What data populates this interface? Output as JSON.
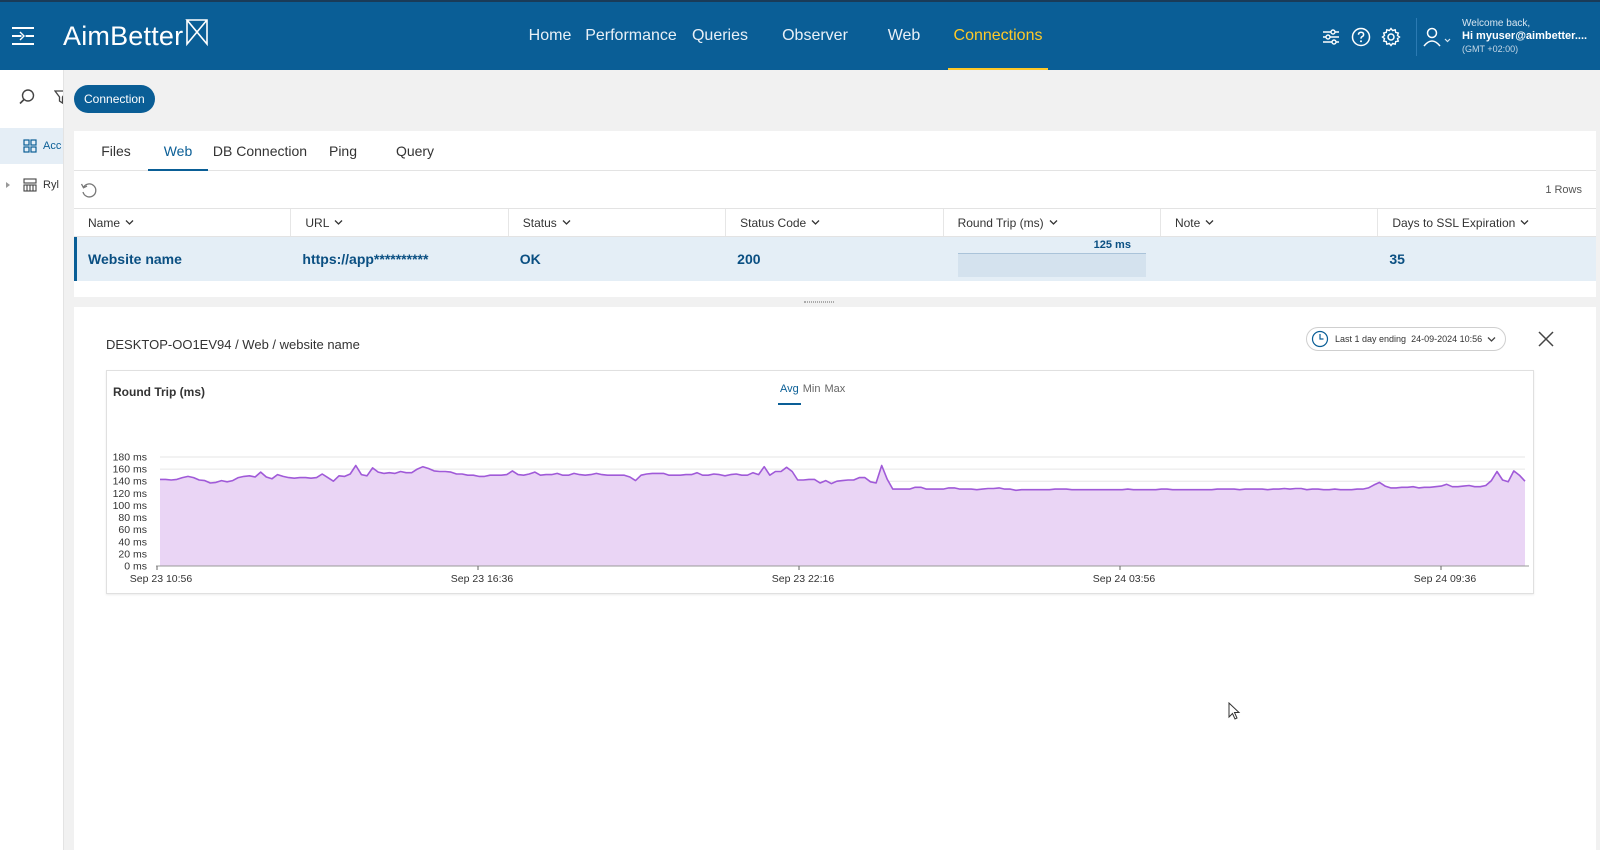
{
  "app": {
    "logo_text": "AimBetter",
    "nav": [
      {
        "label": "Home",
        "active": false
      },
      {
        "label": "Performance",
        "active": false
      },
      {
        "label": "Queries",
        "active": false
      },
      {
        "label": "Observer",
        "active": false
      },
      {
        "label": "Web",
        "active": false
      },
      {
        "label": "Connections",
        "active": true
      }
    ],
    "icons": [
      "filter-settings-icon",
      "help-icon",
      "gear-icon",
      "user-icon"
    ],
    "user": {
      "welcome": "Welcome back,",
      "greeting": "Hi myuser@aimbetter....",
      "timezone": "(GMT +02:00)"
    },
    "colors": {
      "header": "#0a5e96",
      "accent": "#ffc928",
      "chart_fill": "#ead5f5",
      "chart_line": "#a05ad8"
    }
  },
  "sidebar": {
    "items": [
      {
        "label": "Acc",
        "icon": "grid-icon",
        "active": true
      },
      {
        "label": "Ryl",
        "icon": "server-icon",
        "active": false
      }
    ]
  },
  "main": {
    "connection_button": "Connection",
    "tabs": [
      {
        "label": "Files",
        "active": false
      },
      {
        "label": "Web",
        "active": true
      },
      {
        "label": "DB Connection",
        "active": false
      },
      {
        "label": "Ping",
        "active": false
      },
      {
        "label": "Query",
        "active": false
      }
    ],
    "rows_count": "1 Rows",
    "columns": [
      "Name",
      "URL",
      "Status",
      "Status Code",
      "Round Trip (ms)",
      "Note",
      "Days to SSL Expiration"
    ],
    "row": {
      "name": "Website name",
      "url": "https://app**********",
      "status": "OK",
      "status_code": "200",
      "round_trip": "125 ms",
      "note": "",
      "ssl_days": "35"
    }
  },
  "detail": {
    "breadcrumb": "DESKTOP-OO1EV94 / Web / website name",
    "time_range_label": "Last 1 day ending",
    "time_range_value": "24-09-2024 10:56"
  },
  "chart_data": {
    "type": "area",
    "title": "Round Trip (ms)",
    "aggregations": [
      {
        "label": "Avg",
        "active": true
      },
      {
        "label": "Min",
        "active": false
      },
      {
        "label": "Max",
        "active": false
      }
    ],
    "y_unit": "ms",
    "ylim": [
      0,
      180
    ],
    "y_ticks": [
      0,
      20,
      40,
      60,
      80,
      100,
      120,
      140,
      160,
      180
    ],
    "x_ticks": [
      "Sep 23 10:56",
      "Sep 23 16:36",
      "Sep 23 22:16",
      "Sep 24 03:56",
      "Sep 24 09:36"
    ],
    "grid": true,
    "series": [
      {
        "values": [
          143,
          143,
          142,
          143,
          146,
          148,
          146,
          142,
          141,
          137,
          138,
          141,
          139,
          141,
          146,
          148,
          149,
          147,
          155,
          147,
          144,
          151,
          148,
          146,
          145,
          146,
          146,
          145,
          146,
          152,
          146,
          140,
          149,
          148,
          152,
          166,
          151,
          149,
          162,
          155,
          153,
          154,
          153,
          156,
          154,
          154,
          160,
          164,
          161,
          157,
          156,
          156,
          155,
          152,
          152,
          150,
          150,
          148,
          148,
          150,
          150,
          150,
          151,
          157,
          151,
          150,
          152,
          155,
          150,
          151,
          151,
          153,
          150,
          150,
          153,
          151,
          150,
          151,
          153,
          151,
          150,
          150,
          150,
          150,
          147,
          141,
          150,
          152,
          153,
          153,
          153,
          150,
          150,
          150,
          151,
          151,
          154,
          150,
          150,
          152,
          151,
          149,
          151,
          152,
          150,
          150,
          154,
          151,
          164,
          150,
          156,
          156,
          163,
          156,
          142,
          142,
          143,
          143,
          137,
          141,
          136,
          140,
          141,
          142,
          142,
          146,
          146,
          139,
          137,
          166,
          143,
          127,
          127,
          127,
          127,
          130,
          130,
          127,
          127,
          127,
          127,
          129,
          129,
          127,
          127,
          127,
          126,
          127,
          128,
          128,
          129,
          127,
          127,
          125,
          126,
          126,
          126,
          126,
          126,
          126,
          127,
          127,
          127,
          126,
          126,
          126,
          126,
          126,
          126,
          126,
          126,
          126,
          126,
          127,
          126,
          126,
          126,
          126,
          126,
          127,
          127,
          126,
          126,
          126,
          126,
          126,
          126,
          126,
          126,
          127,
          127,
          127,
          127,
          126,
          127,
          127,
          127,
          127,
          126,
          127,
          127,
          128,
          127,
          128,
          128,
          126,
          127,
          127,
          126,
          126,
          127,
          126,
          126,
          126,
          127,
          127,
          129,
          134,
          138,
          132,
          129,
          129,
          130,
          130,
          131,
          129,
          130,
          130,
          131,
          132,
          135,
          131,
          131,
          132,
          133,
          131,
          131,
          133,
          141,
          156,
          142,
          139,
          157,
          150,
          140
        ]
      }
    ]
  }
}
